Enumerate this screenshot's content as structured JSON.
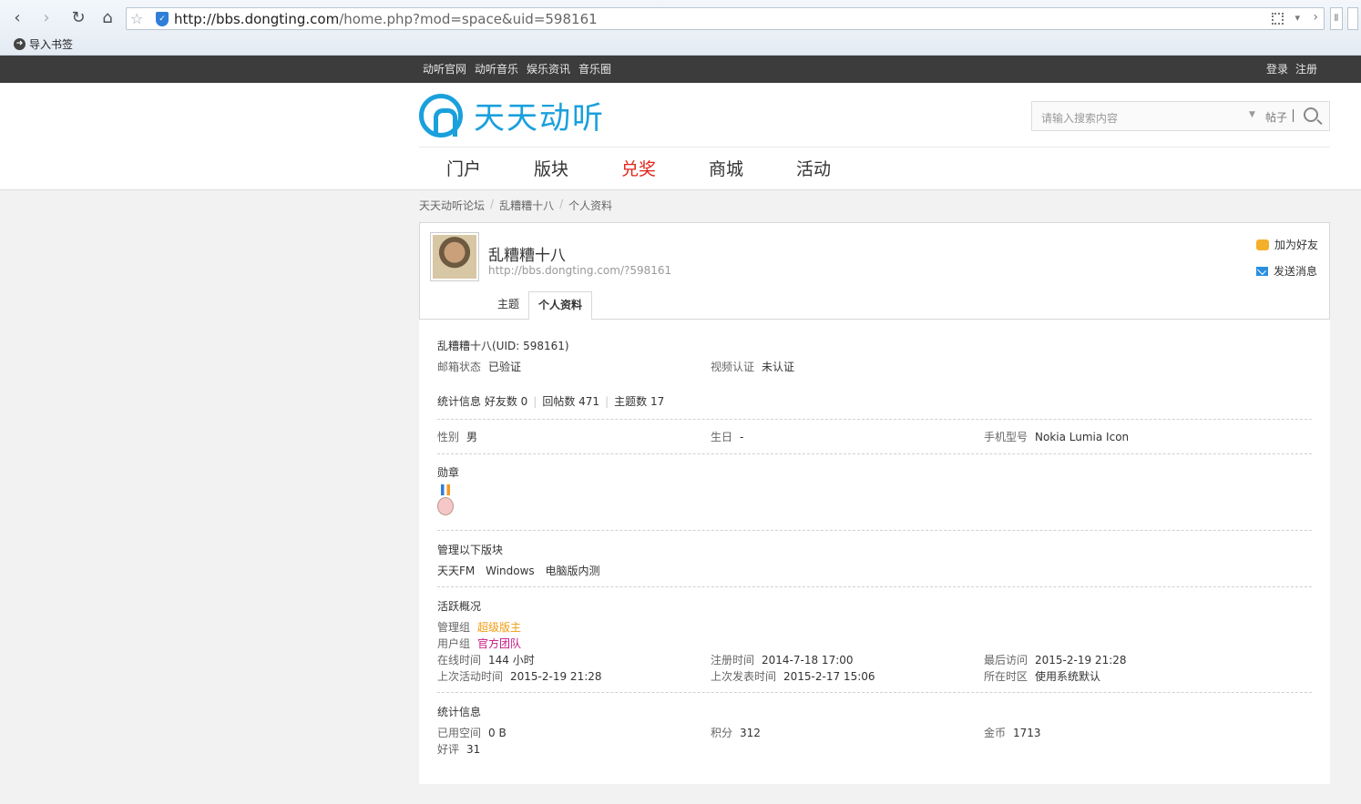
{
  "browser": {
    "url_domain": "http://bbs.dongting.com",
    "url_path": "/home.php?mod=space&uid=598161",
    "bookmark_label": "导入书签"
  },
  "topbar": {
    "links": [
      "动听官网",
      "动听音乐",
      "娱乐资讯",
      "音乐圈"
    ],
    "login": "登录",
    "register": "注册"
  },
  "header": {
    "logo_text": "天天动听",
    "search_placeholder": "请输入搜索内容",
    "search_type": "帖子",
    "nav": [
      "门户",
      "版块",
      "兑奖",
      "商城",
      "活动"
    ],
    "nav_hot_color": "#e1251b"
  },
  "breadcrumb": [
    "天天动听论坛",
    "乱糟糟十八",
    "个人资料"
  ],
  "profile": {
    "username": "乱糟糟十八",
    "link": "http://bbs.dongting.com/?598161",
    "add_friend": "加为好友",
    "send_message": "发送消息",
    "tabs": [
      "主题",
      "个人资料"
    ],
    "active_tab": "个人资料"
  },
  "details": {
    "title": "乱糟糟十八(UID: 598161)",
    "email_label": "邮箱状态",
    "email_value": "已验证",
    "video_label": "视频认证",
    "video_value": "未认证",
    "stats_label": "统计信息",
    "friends": "好友数 0",
    "replies": "回帖数 471",
    "topics": "主题数 17",
    "gender_label": "性别",
    "gender_value": "男",
    "birthday_label": "生日",
    "birthday_value": "-",
    "phone_label": "手机型号",
    "phone_value": "Nokia Lumia Icon",
    "medal_title": "勋章",
    "manage_title": "管理以下版块",
    "manage_forums": [
      "天天FM",
      "Windows",
      "电脑版内测"
    ],
    "activity_title": "活跃概况",
    "admin_group_label": "管理组",
    "admin_group_value": "超级版主",
    "user_group_label": "用户组",
    "user_group_value": "官方团队",
    "online_label": "在线时间",
    "online_value": "144 小时",
    "register_label": "注册时间",
    "register_value": "2014-7-18 17:00",
    "last_visit_label": "最后访问",
    "last_visit_value": "2015-2-19 21:28",
    "last_active_label": "上次活动时间",
    "last_active_value": "2015-2-19 21:28",
    "last_post_label": "上次发表时间",
    "last_post_value": "2015-2-17 15:06",
    "timezone_label": "所在时区",
    "timezone_value": "使用系统默认",
    "stats_title": "统计信息",
    "space_label": "已用空间",
    "space_value": "0 B",
    "points_label": "积分",
    "points_value": "312",
    "coins_label": "金币",
    "coins_value": "1713",
    "rating_label": "好评",
    "rating_value": "31"
  }
}
